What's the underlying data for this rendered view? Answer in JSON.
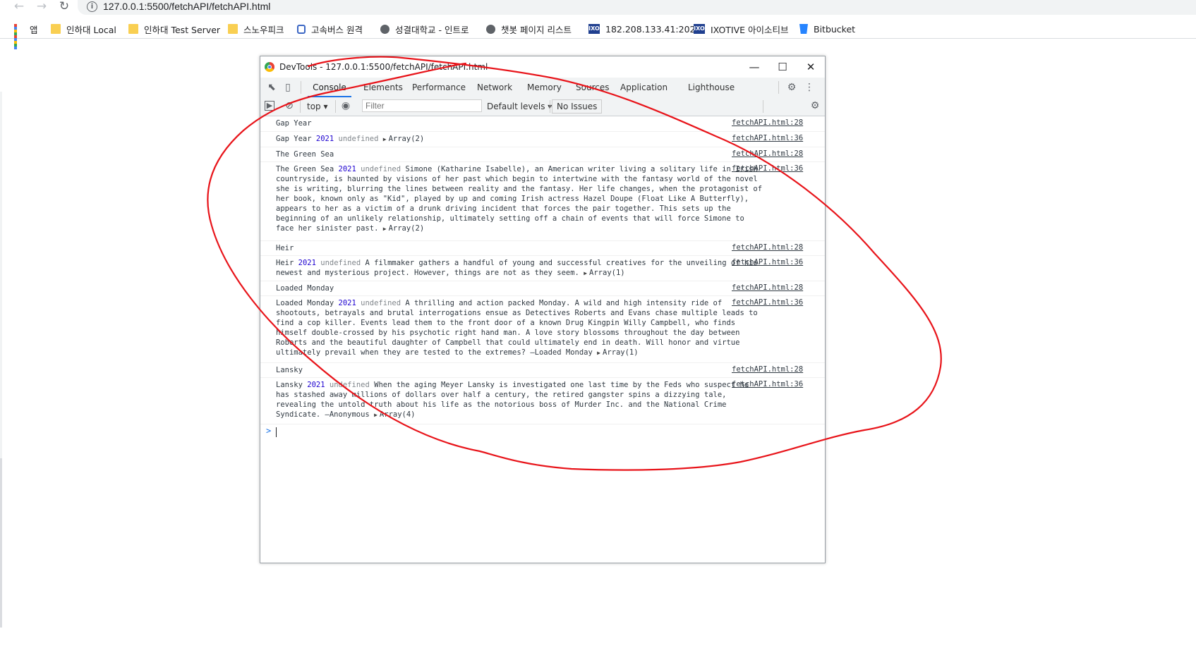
{
  "browser": {
    "url": "127.0.0.1:5500/fetchAPI/fetchAPI.html",
    "bookmarks": [
      {
        "label": "앱",
        "icon": "apps-grid-icon"
      },
      {
        "label": "인하대 Local",
        "icon": "folder-icon"
      },
      {
        "label": "인하대 Test Server",
        "icon": "folder-icon"
      },
      {
        "label": "스노우피크",
        "icon": "folder-icon"
      },
      {
        "label": "고속버스 원격",
        "icon": "lock-icon"
      },
      {
        "label": "성결대학교 - 인트로",
        "icon": "globe-icon"
      },
      {
        "label": "챗봇 페이지 리스트",
        "icon": "globe-icon"
      },
      {
        "label": "182.208.133.41:2020",
        "icon": "ixo-icon"
      },
      {
        "label": "IXOTIVE 아이소티브",
        "icon": "ixo-icon"
      },
      {
        "label": "Bitbucket",
        "icon": "bitbucket-icon"
      }
    ]
  },
  "devtools": {
    "title": "DevTools - 127.0.0.1:5500/fetchAPI/fetchAPI.html",
    "tabs": [
      "Console",
      "Elements",
      "Performance",
      "Network",
      "Memory",
      "Sources",
      "Application",
      "Lighthouse"
    ],
    "active_tab": "Console",
    "toolbar": {
      "context": "top",
      "filter_placeholder": "Filter",
      "levels": "Default levels",
      "issues": "No Issues"
    },
    "messages": [
      {
        "text": "Gap Year",
        "source": "fetchAPI.html:28"
      },
      {
        "title": "Gap Year",
        "year": "2021",
        "undef": "undefined",
        "body": "",
        "array": "Array(2)",
        "source": "fetchAPI.html:36"
      },
      {
        "text": "The Green Sea",
        "source": "fetchAPI.html:28"
      },
      {
        "title": "The Green Sea",
        "year": "2021",
        "undef": "undefined",
        "body": "Simone (Katharine Isabelle), an American writer living a solitary life in Irish countryside, is haunted by visions of her past which begin to intertwine with the fantasy world of the novel she is writing, blurring the lines between reality and the fantasy. Her life changes, when the protagonist of her book, known only as \"Kid\", played by up and coming Irish actress Hazel Doupe (Float Like A Butterfly), appears to her as a victim of a drunk driving incident that forces the pair together. This sets up the beginning of an unlikely relationship, ultimately setting off a chain of events that will force Simone to face her sinister past.",
        "array": "Array(2)",
        "source": "fetchAPI.html:36"
      },
      {
        "text": "Heir",
        "source": "fetchAPI.html:28"
      },
      {
        "title": "Heir",
        "year": "2021",
        "undef": "undefined",
        "body": "A filmmaker gathers a handful of young and successful creatives for the unveiling of his newest and mysterious project. However, things are not as they seem.",
        "array": "Array(1)",
        "source": "fetchAPI.html:36"
      },
      {
        "text": "Loaded Monday",
        "source": "fetchAPI.html:28"
      },
      {
        "title": "Loaded Monday",
        "year": "2021",
        "undef": "undefined",
        "body": "A thrilling and action packed Monday. A wild and high intensity ride of shootouts, betrayals and brutal interrogations ensue as Detectives Roberts and Evans chase multiple leads to find a cop killer. Events lead them to the front door of a known Drug Kingpin Willy Campbell, who finds himself double-crossed by his psychotic right hand man. A love story blossoms throughout the day between Roberts and the beautiful daughter of Campbell that could ultimately end in death. Will honor and virtue ultimately prevail when they are tested to the extremes? —Loaded Monday",
        "array": "Array(1)",
        "source": "fetchAPI.html:36"
      },
      {
        "text": "Lansky",
        "source": "fetchAPI.html:28"
      },
      {
        "title": "Lansky",
        "year": "2021",
        "undef": "undefined",
        "body": "When the aging Meyer Lansky is investigated one last time by the Feds who suspect he has stashed away millions of dollars over half a century, the retired gangster spins a dizzying tale, revealing the untold truth about his life as the notorious boss of Murder Inc. and the National Crime Syndicate. —Anonymous",
        "array": "Array(4)",
        "source": "fetchAPI.html:36"
      }
    ],
    "prompt_symbol": ">"
  },
  "annotation_color": "#e8141a"
}
